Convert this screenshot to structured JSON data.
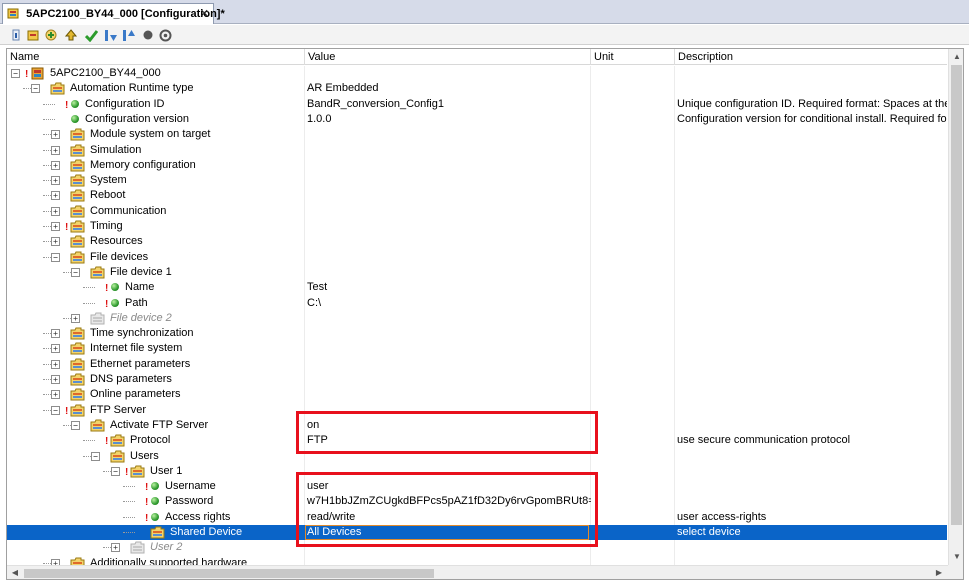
{
  "window": {
    "tab_title": "5APC2100_BY44_000 [Configuration]*",
    "close_glyph": "✕"
  },
  "toolbar": {
    "buttons": [
      "info-icon",
      "properties-icon",
      "add-icon",
      "up-icon",
      "check-icon",
      "sort-down-icon",
      "sort-up-icon",
      "record-icon",
      "settings-icon"
    ]
  },
  "columns": {
    "name": "Name",
    "value": "Value",
    "unit": "Unit",
    "description": "Description"
  },
  "rows": [
    {
      "label": "5APC2100_BY44_000",
      "value": "",
      "desc": ""
    },
    {
      "label": "Automation Runtime type",
      "value": "AR Embedded",
      "desc": ""
    },
    {
      "label": "Configuration ID",
      "value": "BandR_conversion_Config1",
      "desc": "Unique configuration ID. Required format: Spaces at the beginning o"
    },
    {
      "label": "Configuration version",
      "value": "1.0.0",
      "desc": "Configuration version for conditional install. Required format: X.Y.Z w"
    },
    {
      "label": "Module system on target",
      "value": "",
      "desc": ""
    },
    {
      "label": "Simulation",
      "value": "",
      "desc": ""
    },
    {
      "label": "Memory configuration",
      "value": "",
      "desc": ""
    },
    {
      "label": "System",
      "value": "",
      "desc": ""
    },
    {
      "label": "Reboot",
      "value": "",
      "desc": ""
    },
    {
      "label": "Communication",
      "value": "",
      "desc": ""
    },
    {
      "label": "Timing",
      "value": "",
      "desc": ""
    },
    {
      "label": "Resources",
      "value": "",
      "desc": ""
    },
    {
      "label": "File devices",
      "value": "",
      "desc": ""
    },
    {
      "label": "File device 1",
      "value": "",
      "desc": ""
    },
    {
      "label": "Name",
      "value": "Test",
      "desc": ""
    },
    {
      "label": "Path",
      "value": "C:\\",
      "desc": ""
    },
    {
      "label": "File device 2",
      "value": "",
      "desc": ""
    },
    {
      "label": "Time synchronization",
      "value": "",
      "desc": ""
    },
    {
      "label": "Internet file system",
      "value": "",
      "desc": ""
    },
    {
      "label": "Ethernet parameters",
      "value": "",
      "desc": ""
    },
    {
      "label": "DNS parameters",
      "value": "",
      "desc": ""
    },
    {
      "label": "Online parameters",
      "value": "",
      "desc": ""
    },
    {
      "label": "FTP Server",
      "value": "",
      "desc": ""
    },
    {
      "label": "Activate FTP Server",
      "value": "on",
      "desc": ""
    },
    {
      "label": "Protocol",
      "value": "FTP",
      "desc": "use secure communication protocol"
    },
    {
      "label": "Users",
      "value": "",
      "desc": ""
    },
    {
      "label": "User 1",
      "value": "",
      "desc": ""
    },
    {
      "label": "Username",
      "value": "user",
      "desc": ""
    },
    {
      "label": "Password",
      "value": "w7H1bbJZmZCUgkdBFPcs5pAZ1fD32Dy6rvGpomBRUt8=",
      "desc": ""
    },
    {
      "label": "Access rights",
      "value": "read/write",
      "desc": "user access-rights"
    },
    {
      "label": "Shared Device",
      "value": "All Devices",
      "desc": "select device"
    },
    {
      "label": "User 2",
      "value": "",
      "desc": ""
    },
    {
      "label": "Additionally supported hardware",
      "value": "",
      "desc": ""
    }
  ],
  "colors": {
    "selection": "#0a64c8",
    "highlight_box": "#e8101c"
  }
}
